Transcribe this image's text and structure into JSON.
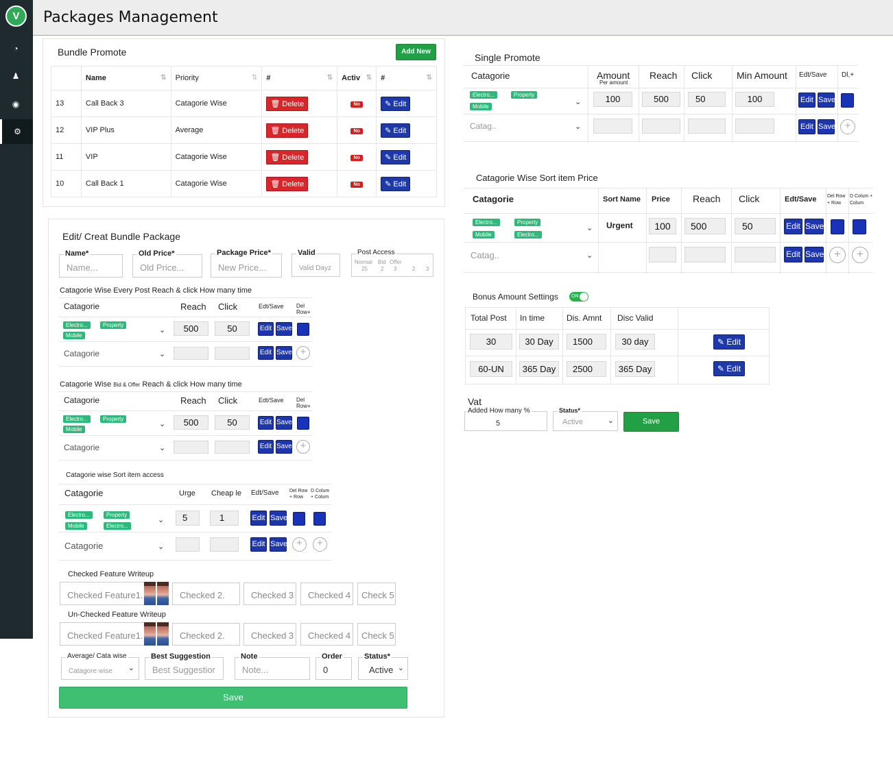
{
  "sidebar": {
    "logo_letter": "V",
    "icons": [
      "dashboard-icon",
      "users-icon",
      "lock-icon",
      "packages-icon"
    ]
  },
  "page_title": "Packages Management",
  "bundle_promote": {
    "title": "Bundle Promote",
    "add_new": "Add New",
    "headers": [
      "Name",
      "Priority",
      "#",
      "Activ",
      "#"
    ],
    "rows": [
      {
        "id": "13",
        "name": "Call Back 3",
        "priority": "Catagorie Wise",
        "delete": "Delete",
        "status": "No",
        "edit": "Edit"
      },
      {
        "id": "12",
        "name": "VIP Plus",
        "priority": "Average",
        "delete": "Delete",
        "status": "No",
        "edit": "Edit"
      },
      {
        "id": "11",
        "name": "VIP",
        "priority": "Catagorie Wise",
        "delete": "Delete",
        "status": "No",
        "edit": "Edit"
      },
      {
        "id": "10",
        "name": "Call Back 1",
        "priority": "Catagorie Wise",
        "delete": "Delete",
        "status": "No",
        "edit": "Edit"
      }
    ]
  },
  "edit_bundle": {
    "title": "Edit/ Creat Bundle Package",
    "fields": {
      "name": {
        "label": "Name*",
        "placeholder": "Name..."
      },
      "old_price": {
        "label": "Old Price*",
        "placeholder": "Old Price..."
      },
      "package_price": {
        "label": "Package Price*",
        "placeholder": "New Price..."
      },
      "valid": {
        "label": "Valid",
        "placeholder": "Valid Dayz"
      },
      "post_access": {
        "label": "Post Access",
        "sub": [
          "Normal",
          "Bid",
          "Offer"
        ],
        "values": [
          "25",
          "2",
          "3",
          "2",
          "3"
        ]
      }
    },
    "sec1": {
      "title": "Catagorie Wise Every Post Reach & click How many time",
      "h_cat": "Catagorie",
      "h_reach": "Reach",
      "h_click": "Click",
      "h_edt": "Edt/Save",
      "h_del": "Del Row+",
      "tags": [
        "Electro...",
        "Property",
        "Mobile"
      ],
      "reach": "500",
      "click": "50",
      "cat_placeholder": "Catagorie",
      "edit": "Edit",
      "save": "Save"
    },
    "sec2": {
      "title": "Catagorie Wise",
      "title_small": "Bid & Offer",
      "title_end": "Reach & click How many time",
      "h_cat": "Catagorie",
      "h_reach": "Reach",
      "h_click": "Click",
      "h_edt": "Edt/Save",
      "h_del": "Del Row+",
      "tags": [
        "Electro...",
        "Property",
        "Mobile"
      ],
      "reach": "500",
      "click": "50",
      "cat_placeholder": "Catagorie",
      "edit": "Edit",
      "save": "Save"
    },
    "sec3": {
      "title": "Catagorie wise Sort item access",
      "h_cat": "Catagorie",
      "h_urg": "Urge",
      "h_cheap": "Cheap le",
      "h_edt": "Edt/Save",
      "h_delrow": "Del Row + Row",
      "h_dcol": "D Colum + Colum",
      "tags": [
        "Electro...",
        "Property",
        "Mobile",
        "Electro..."
      ],
      "urg": "5",
      "cheap": "1",
      "cat_placeholder": "Catagorie",
      "edit": "Edit",
      "save": "Save"
    },
    "checked": {
      "title": "Checked Feature Writeup",
      "items": [
        "Checked Feature1.",
        "Checked 2.",
        "Checked 3",
        "Checked 4",
        "Check 5"
      ]
    },
    "unchecked": {
      "title": "Un-Checked Feature Writeup",
      "items": [
        "Checked Feature1.",
        "Checked 2.",
        "Checked 3",
        "Checked 4",
        "Check 5"
      ]
    },
    "bottom": {
      "avg": {
        "label": "Average/ Cata wise",
        "value": "Catagore wise"
      },
      "best": {
        "label": "Best Suggestion",
        "placeholder": "Best Suggestior"
      },
      "note": {
        "label": "Note",
        "placeholder": "Note..."
      },
      "order": {
        "label": "Order",
        "value": "0"
      },
      "status": {
        "label": "Status*",
        "value": "Active"
      }
    },
    "save": "Save"
  },
  "single_promote": {
    "title": "Single Promote",
    "headers": {
      "cat": "Catagorie",
      "amount": "Amount",
      "amount_sub": "Per amount",
      "reach": "Reach",
      "click": "Click",
      "min": "Min Amount",
      "edt": "Edt/Save",
      "dl": "Dl,+"
    },
    "tags": [
      "Electro...",
      "Property",
      "Mobile"
    ],
    "amount": "100",
    "reach": "500",
    "click": "50",
    "min": "100",
    "cat_placeholder": "Catag..",
    "edit": "Edit",
    "save": "Save"
  },
  "sort_price": {
    "title": "Catagorie Wise Sort item Price",
    "headers": {
      "cat": "Catagorie",
      "sort": "Sort Name",
      "price": "Price",
      "reach": "Reach",
      "click": "Click",
      "edt": "Edt/Save",
      "delrow": "Del Row + Row",
      "dcol": "D Colum + Colum"
    },
    "tags": [
      "Electro...",
      "Property",
      "Mobile",
      "Electro..."
    ],
    "sort_name": "Urgent",
    "price": "100",
    "reach": "500",
    "click": "50",
    "cat_placeholder": "Catag..",
    "edit": "Edit",
    "save": "Save"
  },
  "bonus": {
    "title": "Bonus Amount Settings",
    "toggle": "ON",
    "headers": [
      "Total Post",
      "In time",
      "Dis. Amnt",
      "Disc Valid"
    ],
    "rows": [
      {
        "post": "30",
        "time": "30 Day",
        "amnt": "1500",
        "valid": "30 day",
        "edit": "Edit"
      },
      {
        "post": "60-UN",
        "time": "365 Day",
        "amnt": "2500",
        "valid": "365 Day",
        "edit": "Edit"
      }
    ]
  },
  "vat": {
    "title": "Vat",
    "label": "Added How many %",
    "value": "5",
    "status_label": "Status*",
    "status_value": "Active",
    "save": "Save"
  },
  "colors": {
    "sidebar": "#1f2a2e",
    "green": "#22a045",
    "blue": "#1e35b0",
    "red": "#d9262b",
    "tag": "#2eb87a"
  }
}
